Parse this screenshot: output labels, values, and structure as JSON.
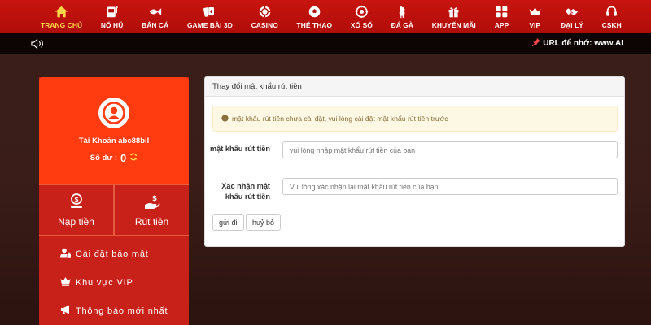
{
  "nav": {
    "items": [
      {
        "label": "TRANG CHỦ",
        "icon": "home-icon",
        "active": true
      },
      {
        "label": "NỔ HŨ",
        "icon": "slot-machine-icon"
      },
      {
        "label": "BẮN CÁ",
        "icon": "fish-icon"
      },
      {
        "label": "GAME BÀI 3D",
        "icon": "cards-icon"
      },
      {
        "label": "CASINO",
        "icon": "chip-icon"
      },
      {
        "label": "THỂ THAO",
        "icon": "soccer-ball-icon"
      },
      {
        "label": "XỔ SỐ",
        "icon": "lottery-icon"
      },
      {
        "label": "ĐÁ GÀ",
        "icon": "rooster-icon"
      },
      {
        "label": "KHUYẾN MÃI",
        "icon": "gift-icon"
      },
      {
        "label": "APP",
        "icon": "app-grid-icon"
      },
      {
        "label": "VIP",
        "icon": "crown-icon"
      },
      {
        "label": "ĐẠI LÝ",
        "icon": "handshake-icon"
      },
      {
        "label": "CSKH",
        "icon": "support-icon"
      }
    ],
    "active_color": "#ffd84a",
    "bar_color": "#c8140e"
  },
  "subbar": {
    "url_note": "URL để nhớ: www.AI"
  },
  "sidebar": {
    "account_label": "Tài Khoản abc88bil",
    "balance_label": "Số dư :",
    "balance_value": "0",
    "quick_actions": [
      {
        "label": "Nạp tiền",
        "icon": "deposit-icon"
      },
      {
        "label": "Rút tiền",
        "icon": "withdraw-icon"
      }
    ],
    "menu": [
      {
        "label": "Cài đặt bảo mật",
        "icon": "user-lock-icon"
      },
      {
        "label": "Khu vực VIP",
        "icon": "crown-icon"
      },
      {
        "label": "Thông báo mới nhất",
        "icon": "megaphone-icon"
      }
    ]
  },
  "panel": {
    "title": "Thay đổi mật khẩu rút tiền",
    "alert": "mật khẩu rút tiền chưa cài đặt, vui lòng cài đặt mật khẩu rút tiền trước",
    "password_label": "mật khẩu rút tiền",
    "password_placeholder": "vui lòng nhập mật khẩu rút tiền của bạn",
    "password_value": "",
    "confirm_label": "Xác nhận mật khẩu rút tiền",
    "confirm_placeholder": "Vui lòng xác nhận lại mật khẩu rút tiền của bạn",
    "confirm_value": "",
    "submit_label": "gửi đi",
    "cancel_label": "huỷ bỏ"
  }
}
